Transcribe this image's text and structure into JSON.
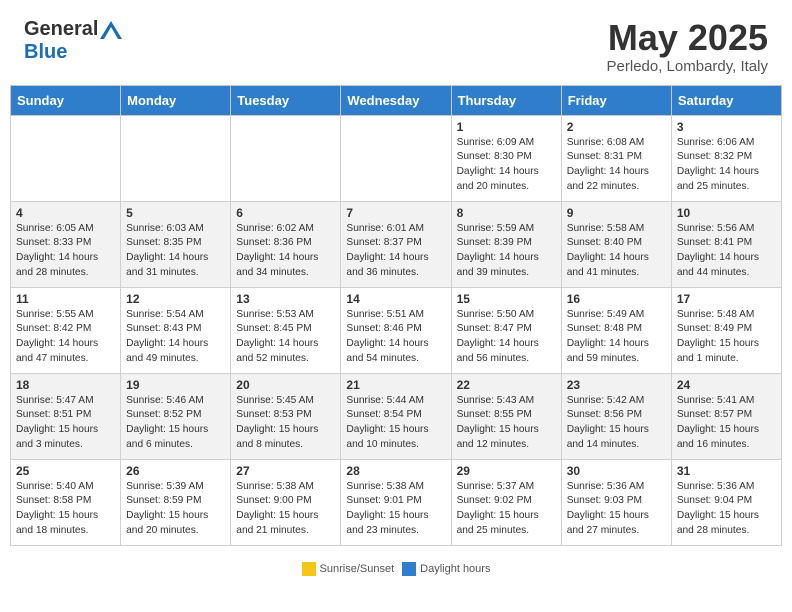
{
  "header": {
    "logo_general": "General",
    "logo_blue": "Blue",
    "month_title": "May 2025",
    "location": "Perledo, Lombardy, Italy"
  },
  "weekdays": [
    "Sunday",
    "Monday",
    "Tuesday",
    "Wednesday",
    "Thursday",
    "Friday",
    "Saturday"
  ],
  "weeks": [
    [
      {
        "day": "",
        "info": ""
      },
      {
        "day": "",
        "info": ""
      },
      {
        "day": "",
        "info": ""
      },
      {
        "day": "",
        "info": ""
      },
      {
        "day": "1",
        "info": "Sunrise: 6:09 AM\nSunset: 8:30 PM\nDaylight: 14 hours and 20 minutes."
      },
      {
        "day": "2",
        "info": "Sunrise: 6:08 AM\nSunset: 8:31 PM\nDaylight: 14 hours and 22 minutes."
      },
      {
        "day": "3",
        "info": "Sunrise: 6:06 AM\nSunset: 8:32 PM\nDaylight: 14 hours and 25 minutes."
      }
    ],
    [
      {
        "day": "4",
        "info": "Sunrise: 6:05 AM\nSunset: 8:33 PM\nDaylight: 14 hours and 28 minutes."
      },
      {
        "day": "5",
        "info": "Sunrise: 6:03 AM\nSunset: 8:35 PM\nDaylight: 14 hours and 31 minutes."
      },
      {
        "day": "6",
        "info": "Sunrise: 6:02 AM\nSunset: 8:36 PM\nDaylight: 14 hours and 34 minutes."
      },
      {
        "day": "7",
        "info": "Sunrise: 6:01 AM\nSunset: 8:37 PM\nDaylight: 14 hours and 36 minutes."
      },
      {
        "day": "8",
        "info": "Sunrise: 5:59 AM\nSunset: 8:39 PM\nDaylight: 14 hours and 39 minutes."
      },
      {
        "day": "9",
        "info": "Sunrise: 5:58 AM\nSunset: 8:40 PM\nDaylight: 14 hours and 41 minutes."
      },
      {
        "day": "10",
        "info": "Sunrise: 5:56 AM\nSunset: 8:41 PM\nDaylight: 14 hours and 44 minutes."
      }
    ],
    [
      {
        "day": "11",
        "info": "Sunrise: 5:55 AM\nSunset: 8:42 PM\nDaylight: 14 hours and 47 minutes."
      },
      {
        "day": "12",
        "info": "Sunrise: 5:54 AM\nSunset: 8:43 PM\nDaylight: 14 hours and 49 minutes."
      },
      {
        "day": "13",
        "info": "Sunrise: 5:53 AM\nSunset: 8:45 PM\nDaylight: 14 hours and 52 minutes."
      },
      {
        "day": "14",
        "info": "Sunrise: 5:51 AM\nSunset: 8:46 PM\nDaylight: 14 hours and 54 minutes."
      },
      {
        "day": "15",
        "info": "Sunrise: 5:50 AM\nSunset: 8:47 PM\nDaylight: 14 hours and 56 minutes."
      },
      {
        "day": "16",
        "info": "Sunrise: 5:49 AM\nSunset: 8:48 PM\nDaylight: 14 hours and 59 minutes."
      },
      {
        "day": "17",
        "info": "Sunrise: 5:48 AM\nSunset: 8:49 PM\nDaylight: 15 hours and 1 minute."
      }
    ],
    [
      {
        "day": "18",
        "info": "Sunrise: 5:47 AM\nSunset: 8:51 PM\nDaylight: 15 hours and 3 minutes."
      },
      {
        "day": "19",
        "info": "Sunrise: 5:46 AM\nSunset: 8:52 PM\nDaylight: 15 hours and 6 minutes."
      },
      {
        "day": "20",
        "info": "Sunrise: 5:45 AM\nSunset: 8:53 PM\nDaylight: 15 hours and 8 minutes."
      },
      {
        "day": "21",
        "info": "Sunrise: 5:44 AM\nSunset: 8:54 PM\nDaylight: 15 hours and 10 minutes."
      },
      {
        "day": "22",
        "info": "Sunrise: 5:43 AM\nSunset: 8:55 PM\nDaylight: 15 hours and 12 minutes."
      },
      {
        "day": "23",
        "info": "Sunrise: 5:42 AM\nSunset: 8:56 PM\nDaylight: 15 hours and 14 minutes."
      },
      {
        "day": "24",
        "info": "Sunrise: 5:41 AM\nSunset: 8:57 PM\nDaylight: 15 hours and 16 minutes."
      }
    ],
    [
      {
        "day": "25",
        "info": "Sunrise: 5:40 AM\nSunset: 8:58 PM\nDaylight: 15 hours and 18 minutes."
      },
      {
        "day": "26",
        "info": "Sunrise: 5:39 AM\nSunset: 8:59 PM\nDaylight: 15 hours and 20 minutes."
      },
      {
        "day": "27",
        "info": "Sunrise: 5:38 AM\nSunset: 9:00 PM\nDaylight: 15 hours and 21 minutes."
      },
      {
        "day": "28",
        "info": "Sunrise: 5:38 AM\nSunset: 9:01 PM\nDaylight: 15 hours and 23 minutes."
      },
      {
        "day": "29",
        "info": "Sunrise: 5:37 AM\nSunset: 9:02 PM\nDaylight: 15 hours and 25 minutes."
      },
      {
        "day": "30",
        "info": "Sunrise: 5:36 AM\nSunset: 9:03 PM\nDaylight: 15 hours and 27 minutes."
      },
      {
        "day": "31",
        "info": "Sunrise: 5:36 AM\nSunset: 9:04 PM\nDaylight: 15 hours and 28 minutes."
      }
    ]
  ],
  "footer": {
    "sunrise_label": "Sunrise/Sunset",
    "daylight_label": "Daylight hours"
  }
}
